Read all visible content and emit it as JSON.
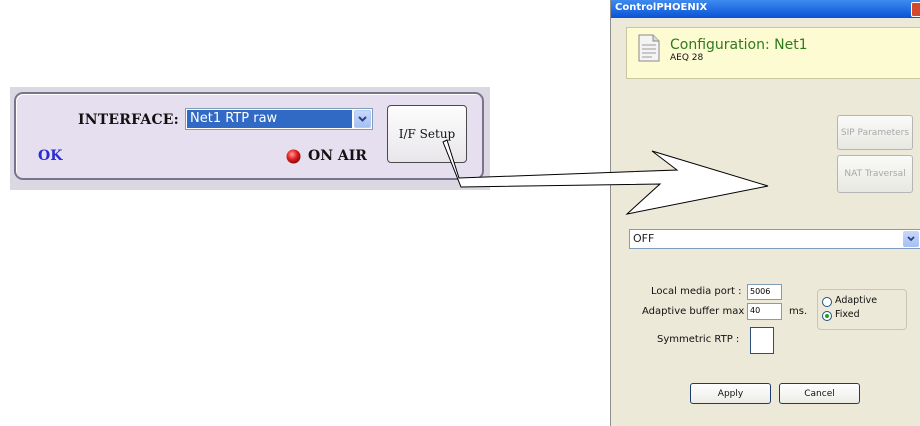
{
  "interface_panel": {
    "label": "INTERFACE:",
    "selected_interface": "Net1 RTP raw",
    "setup_button": "I/F Setup",
    "status": "OK",
    "on_air": "ON AIR",
    "led_color": "#e02020"
  },
  "dialog": {
    "title": "ControlPHOENIX",
    "header": {
      "configuration": "Configuration: Net1",
      "device": "AEQ 28"
    },
    "buttons": {
      "sip_parameters": "SIP Parameters",
      "nat_traversal": "NAT Traversal",
      "apply": "Apply",
      "cancel": "Cancel"
    },
    "combo_value": "OFF",
    "fields": {
      "local_media_port_label": "Local media port :",
      "local_media_port_value": "5006",
      "adaptive_buffer_label": "Adaptive buffer max",
      "adaptive_buffer_value": "40",
      "adaptive_buffer_unit": "ms.",
      "symmetric_rtp_label": "Symmetric RTP :"
    },
    "buffer_mode": {
      "options": [
        "Adaptive",
        "Fixed"
      ],
      "selected": "Fixed"
    }
  },
  "colors": {
    "title_bar": "#0a52d6",
    "selection": "#316ac5",
    "config_text": "#2f7a1e",
    "ok_text": "#2b2bd0"
  }
}
